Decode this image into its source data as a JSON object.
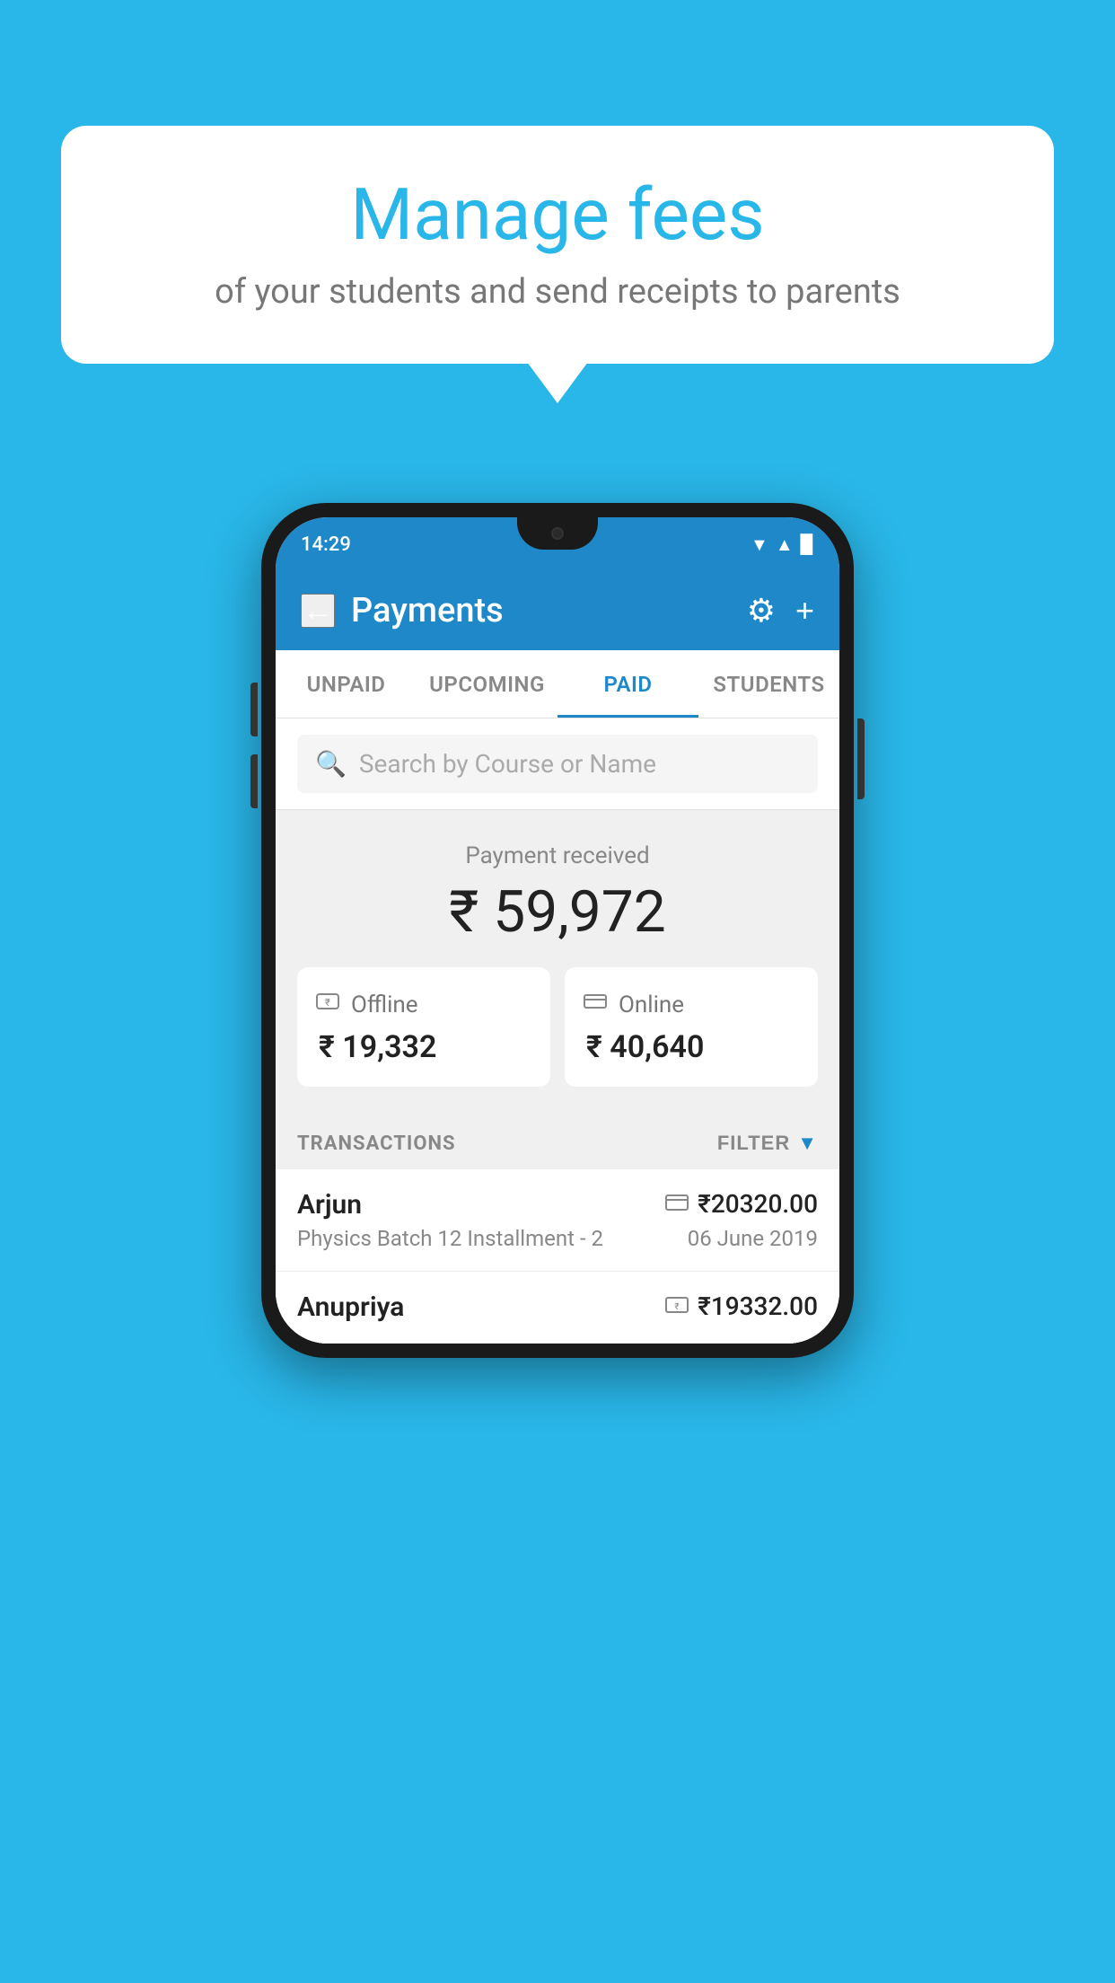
{
  "page": {
    "background_color": "#29b6e8"
  },
  "speech_bubble": {
    "title": "Manage fees",
    "subtitle": "of your students and send receipts to parents"
  },
  "status_bar": {
    "time": "14:29",
    "wifi": "▲",
    "signal": "▲",
    "battery": "▉"
  },
  "header": {
    "title": "Payments",
    "back_label": "←",
    "gear_icon": "⚙",
    "plus_icon": "+"
  },
  "tabs": [
    {
      "label": "UNPAID",
      "active": false
    },
    {
      "label": "UPCOMING",
      "active": false
    },
    {
      "label": "PAID",
      "active": true
    },
    {
      "label": "STUDENTS",
      "active": false
    }
  ],
  "search": {
    "placeholder": "Search by Course or Name"
  },
  "payment_summary": {
    "label": "Payment received",
    "total_amount": "₹ 59,972",
    "offline": {
      "label": "Offline",
      "amount": "₹ 19,332"
    },
    "online": {
      "label": "Online",
      "amount": "₹ 40,640"
    }
  },
  "transactions": {
    "section_label": "TRANSACTIONS",
    "filter_label": "FILTER",
    "items": [
      {
        "name": "Arjun",
        "course": "Physics Batch 12 Installment - 2",
        "amount": "₹20320.00",
        "date": "06 June 2019",
        "payment_mode": "online"
      },
      {
        "name": "Anupriya",
        "course": "",
        "amount": "₹19332.00",
        "date": "",
        "payment_mode": "offline"
      }
    ]
  }
}
